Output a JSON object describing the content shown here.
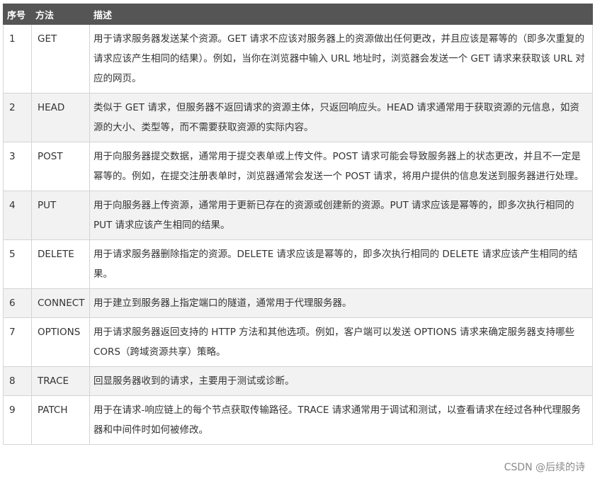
{
  "table": {
    "headers": {
      "num": "序号",
      "method": "方法",
      "desc": "描述"
    },
    "rows": [
      {
        "num": "1",
        "method": "GET",
        "desc": "用于请求服务器发送某个资源。GET 请求不应该对服务器上的资源做出任何更改，并且应该是幂等的（即多次重复的请求应该产生相同的结果）。例如，当你在浏览器中输入 URL 地址时，浏览器会发送一个 GET 请求来获取该 URL 对应的网页。"
      },
      {
        "num": "2",
        "method": "HEAD",
        "desc": "类似于 GET 请求，但服务器不返回请求的资源主体，只返回响应头。HEAD 请求通常用于获取资源的元信息，如资源的大小、类型等，而不需要获取资源的实际内容。"
      },
      {
        "num": "3",
        "method": "POST",
        "desc": "用于向服务器提交数据，通常用于提交表单或上传文件。POST 请求可能会导致服务器上的状态更改，并且不一定是幂等的。例如，在提交注册表单时，浏览器通常会发送一个 POST 请求，将用户提供的信息发送到服务器进行处理。"
      },
      {
        "num": "4",
        "method": "PUT",
        "desc": "用于向服务器上传资源，通常用于更新已存在的资源或创建新的资源。PUT 请求应该是幂等的，即多次执行相同的 PUT 请求应该产生相同的结果。"
      },
      {
        "num": "5",
        "method": "DELETE",
        "desc": "用于请求服务器删除指定的资源。DELETE 请求应该是幂等的，即多次执行相同的 DELETE 请求应该产生相同的结果。"
      },
      {
        "num": "6",
        "method": "CONNECT",
        "desc": "用于建立到服务器上指定端口的隧道，通常用于代理服务器。"
      },
      {
        "num": "7",
        "method": "OPTIONS",
        "desc": "用于请求服务器返回支持的 HTTP 方法和其他选项。例如，客户端可以发送 OPTIONS 请求来确定服务器支持哪些 CORS（跨域资源共享）策略。"
      },
      {
        "num": "8",
        "method": "TRACE",
        "desc": "回显服务器收到的请求，主要用于测试或诊断。"
      },
      {
        "num": "9",
        "method": "PATCH",
        "desc": "用于在请求-响应链上的每个节点获取传输路径。TRACE 请求通常用于调试和测试，以查看请求在经过各种代理服务器和中间件时如何被修改。"
      }
    ]
  },
  "watermark": "CSDN @后续的诗"
}
